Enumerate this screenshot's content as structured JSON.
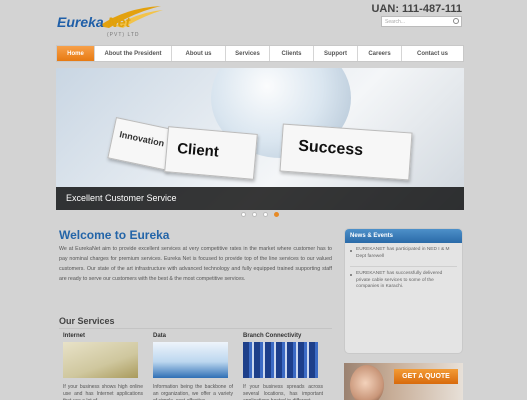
{
  "header": {
    "logo_text_1": "Eureka",
    "logo_text_2": " Net",
    "logo_tagline": "(PVT) LTD",
    "uan": "UAN: 111-487-111",
    "search_placeholder": "Search..."
  },
  "nav": {
    "items": [
      {
        "label": "Home",
        "active": true
      },
      {
        "label": "About the President"
      },
      {
        "label": "About us"
      },
      {
        "label": "Services"
      },
      {
        "label": "Clients"
      },
      {
        "label": "Support"
      },
      {
        "label": "Careers"
      },
      {
        "label": "Contact us"
      }
    ]
  },
  "slider": {
    "card_labels": [
      "Innovation",
      "Client",
      "Success"
    ],
    "caption": "Excellent Customer Service",
    "active_slide": 4,
    "slide_count": 4
  },
  "welcome": {
    "title": "Welcome to Eureka",
    "text": "We at EurekaNet aim to provide excellent services at very competitive rates in the market where customer has to pay nominal charges for premium services. Eureka Net is focused to provide top of the line services to our valued customers. Our state of the art infrastructure with advanced technology and fully equipped trained supporting staff are ready to serve our customers with the best & the most competitive services."
  },
  "services": {
    "title": "Our Services",
    "items": [
      {
        "heading": "Internet",
        "text": "If your business shows high online use and has Internet applications that use a lot of"
      },
      {
        "heading": "Data",
        "text": "Information being the backbone of an organization, we offer a variety of simple, cost-effective"
      },
      {
        "heading": "Branch Connectivity",
        "text": "If your business spreads across several locations, has important applications hosted in different"
      }
    ]
  },
  "news": {
    "title": "News & Events",
    "items": [
      "EUREKANET has participated in NED I & M Dept farewell",
      "EUREKANET has successfully delivered private cable services to some of the companies in Karachi."
    ]
  },
  "quote": {
    "label": "GET A QUOTE"
  },
  "colors": {
    "accent_orange": "#e77a12",
    "brand_blue": "#2465a8",
    "page_bg": "#d3d3d3"
  }
}
